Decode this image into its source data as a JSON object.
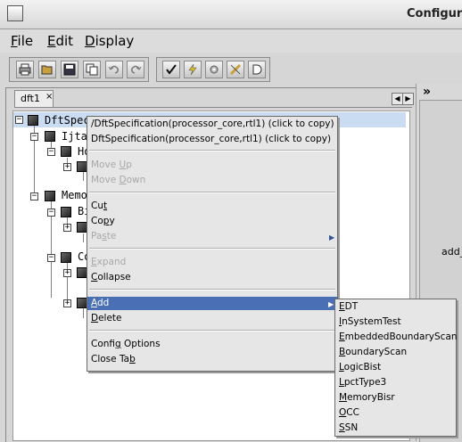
{
  "window": {
    "title": "Configura"
  },
  "menubar": [
    {
      "label": "File",
      "mnemonic": "F",
      "rest": "ile"
    },
    {
      "label": "Edit",
      "mnemonic": "E",
      "rest": "dit"
    },
    {
      "label": "Display",
      "mnemonic": "D",
      "rest": "isplay"
    }
  ],
  "toolbar": {
    "group1": [
      "print-icon",
      "open-folder-icon",
      "save-icon",
      "copy-icon",
      "undo-icon",
      "redo-icon"
    ],
    "group2": [
      "check-icon",
      "lightning-icon",
      "gear-icon",
      "ruler-icon",
      "and-gate-icon"
    ]
  },
  "tabs": [
    {
      "label": "dft1",
      "close": "×"
    }
  ],
  "tab_nav": {
    "left": "◀",
    "right": "▶"
  },
  "tree": {
    "nodes": [
      {
        "label": "DftSpec",
        "expander": "−"
      },
      {
        "label": "Ijta",
        "expander": "−"
      },
      {
        "label": "Ho",
        "expander": "−"
      },
      {
        "label": "",
        "expander": "+"
      },
      {
        "label": "Memo",
        "expander": "−"
      },
      {
        "label": "Bi",
        "expander": "−"
      },
      {
        "label": "",
        "expander": "+"
      },
      {
        "label": "Co",
        "expander": "−"
      },
      {
        "label": "",
        "expander": "+"
      },
      {
        "label": "",
        "expander": "+"
      }
    ]
  },
  "context_menu": {
    "copy_path_1": "/DftSpecification(processor_core,rtl1) (click to copy)",
    "copy_path_2": "DftSpecification(processor_core,rtl1) (click to copy)",
    "move_up": {
      "label": "Move Up",
      "m": "U",
      "pre": "Move ",
      "post": "p"
    },
    "move_down": {
      "label": "Move Down",
      "m": "D",
      "pre": "Move ",
      "post": "own"
    },
    "cut": {
      "label": "Cut",
      "pre": "Cu",
      "m": "t",
      "post": ""
    },
    "copy": {
      "label": "Copy",
      "pre": "Co",
      "m": "p",
      "post": "y"
    },
    "paste": {
      "label": "Paste",
      "pre": "Pa",
      "m": "s",
      "post": "te"
    },
    "expand": {
      "label": "Expand",
      "pre": "",
      "m": "E",
      "post": "xpand"
    },
    "collapse": {
      "label": "Collapse",
      "pre": "",
      "m": "C",
      "post": "ollapse"
    },
    "add": {
      "label": "Add",
      "pre": "",
      "m": "A",
      "post": "dd"
    },
    "delete": {
      "label": "Delete",
      "pre": "",
      "m": "D",
      "post": "elete"
    },
    "config_options": {
      "label": "Config Options",
      "pre": "Confi",
      "m": "g",
      "post": " Options"
    },
    "close_tab": {
      "label": "Close Tab",
      "pre": "Close Ta",
      "m": "b",
      "post": ""
    },
    "submenu_arrow": "▶"
  },
  "add_submenu": [
    {
      "label": "EDT",
      "m": "E",
      "post": "DT"
    },
    {
      "label": "InSystemTest",
      "m": "I",
      "post": "nSystemTest"
    },
    {
      "label": "EmbeddedBoundaryScan",
      "m": "E",
      "post": "mbeddedBoundaryScan"
    },
    {
      "label": "BoundaryScan",
      "m": "B",
      "post": "oundaryScan"
    },
    {
      "label": "LogicBist",
      "m": "L",
      "post": "ogicBist"
    },
    {
      "label": "LpctType3",
      "m": "L",
      "post": "pctType3"
    },
    {
      "label": "MemoryBisr",
      "m": "M",
      "post": "emoryBisr"
    },
    {
      "label": "OCC",
      "m": "O",
      "post": "CC"
    },
    {
      "label": "SSN",
      "m": "S",
      "post": "SN"
    }
  ],
  "right_panel": {
    "chevron": "»",
    "text": "add_"
  }
}
